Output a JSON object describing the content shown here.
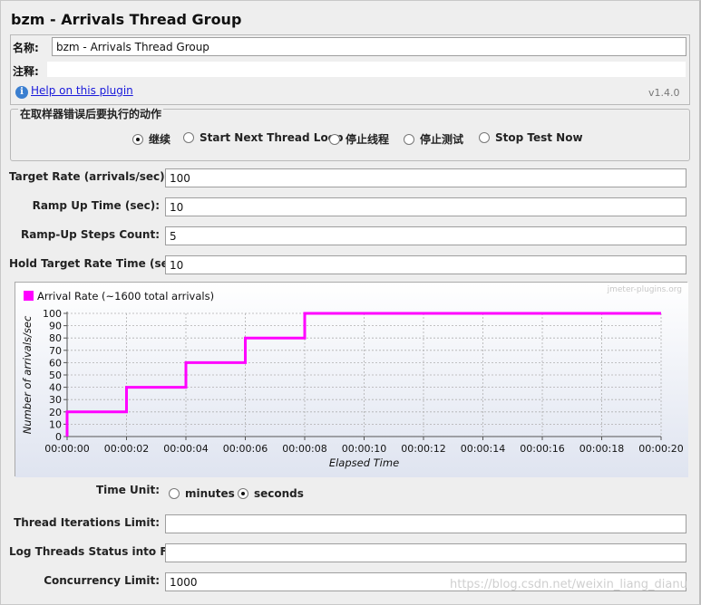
{
  "window": {
    "title": "bzm - Arrivals Thread Group"
  },
  "name_panel": {
    "name_label": "名称:",
    "name_value": "bzm - Arrivals Thread Group",
    "comment_label": "注释:",
    "comment_value": "",
    "help_icon": "i",
    "help_link": "Help on this plugin",
    "version": "v1.4.0"
  },
  "sampler_error": {
    "title": "在取样器错误后要执行的动作",
    "options": [
      {
        "label": "继续",
        "selected": true
      },
      {
        "label": "Start Next Thread Loop",
        "selected": false
      },
      {
        "label": "停止线程",
        "selected": false
      },
      {
        "label": "停止测试",
        "selected": false
      },
      {
        "label": "Stop Test Now",
        "selected": false
      }
    ]
  },
  "fields": {
    "target_rate_label": "Target Rate (arrivals/sec):",
    "target_rate_value": "100",
    "ramp_up_label": "Ramp Up Time (sec):",
    "ramp_up_value": "10",
    "ramp_steps_label": "Ramp-Up Steps Count:",
    "ramp_steps_value": "5",
    "hold_label": "Hold Target Rate Time (sec):",
    "hold_value": "10",
    "time_unit_label": "Time Unit:",
    "time_unit_options": [
      {
        "label": "minutes",
        "selected": false
      },
      {
        "label": "seconds",
        "selected": true
      }
    ],
    "iterations_label": "Thread Iterations Limit:",
    "iterations_value": "",
    "log_label": "Log Threads Status into File:",
    "log_value": "",
    "concurrency_label": "Concurrency Limit:",
    "concurrency_value": "1000"
  },
  "chart_data": {
    "type": "line",
    "watermark": "jmeter-plugins.org",
    "legend": "Arrival Rate (~1600 total arrivals)",
    "legend_placement": "top-left",
    "xlabel": "Elapsed Time",
    "ylabel": "Number of arrivals/sec",
    "x_ticks": [
      "00:00:00",
      "00:00:02",
      "00:00:04",
      "00:00:06",
      "00:00:08",
      "00:00:10",
      "00:00:12",
      "00:00:14",
      "00:00:16",
      "00:00:18",
      "00:00:20"
    ],
    "y_ticks": [
      "0",
      "10",
      "20",
      "30",
      "40",
      "50",
      "60",
      "70",
      "80",
      "90",
      "100"
    ],
    "xlim": [
      0,
      20
    ],
    "ylim": [
      0,
      100
    ],
    "grid": true,
    "series": [
      {
        "name": "Arrival Rate (~1600 total arrivals)",
        "color": "#ff00ff",
        "x": [
          0,
          0,
          2,
          2,
          4,
          4,
          6,
          6,
          8,
          8,
          20
        ],
        "y": [
          0,
          20,
          20,
          40,
          40,
          60,
          60,
          80,
          80,
          100,
          100
        ]
      }
    ]
  },
  "footer": {
    "watermark": "https://blog.csdn.net/weixin_liang_dianu"
  },
  "colors": {
    "accent": "#ff00ff",
    "link": "#1a1adb",
    "background": "#eeeeee"
  }
}
